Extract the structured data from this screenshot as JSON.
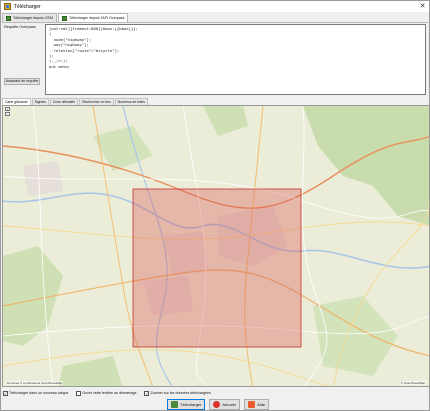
{
  "window": {
    "title": "Télécharger"
  },
  "tabs": [
    {
      "label": "Télécharger depuis OSM"
    },
    {
      "label": "Télécharger depuis l'API Overpass"
    }
  ],
  "query": {
    "label": "Requête Overpass",
    "lines": [
      "[out:xml][timeout:600][bbox:{{bbox}}];",
      "(",
      "  node[\"highway\"];",
      "  way[\"highway\"];",
      "  relation[\"route\"=\"bicycle\"];",
      ");",
      "(._;>;);",
      "out meta;"
    ],
    "assistant_button": "Assistant de requête"
  },
  "map_tabs": [
    "Carte glissante",
    "Signets",
    "Zone délimitée",
    "Rechercher un lieu",
    "Numéros de tuiles"
  ],
  "map": {
    "zoom_in": "+",
    "zoom_out": "-",
    "attribution_left": "Données © contributeurs OpenStreetMap",
    "attribution_right": "© OpenStreetMap",
    "selection_color": "#d9534f"
  },
  "options": [
    {
      "label": "Télécharger dans un nouveau calque",
      "checked": true
    },
    {
      "label": "Ouvrir cette fenêtre au démarrage",
      "checked": false
    },
    {
      "label": "Zoomer sur les données téléchargées",
      "checked": true
    }
  ],
  "buttons": {
    "download": "Télécharger",
    "cancel": "Annuler",
    "help": "Aide"
  }
}
